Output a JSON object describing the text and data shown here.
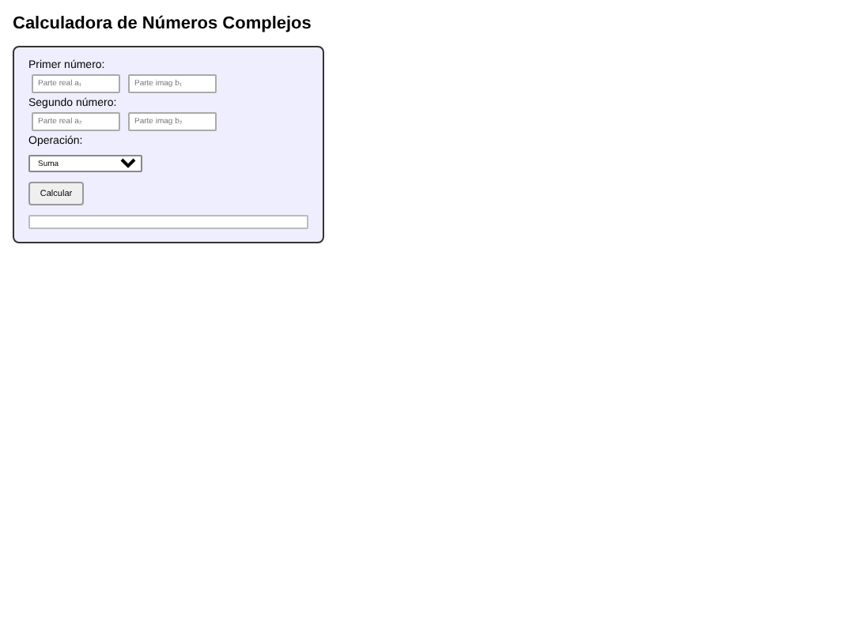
{
  "title": "Calculadora de Números Complejos",
  "groups": [
    {
      "label": "Primer número:",
      "fields": [
        {
          "placeholder": "Parte real a₁"
        },
        {
          "placeholder": "Parte imag b₁"
        }
      ]
    },
    {
      "label": "Segundo número:",
      "fields": [
        {
          "placeholder": "Parte real a₂"
        },
        {
          "placeholder": "Parte imag b₂"
        }
      ]
    }
  ],
  "operation": {
    "label": "Operación:",
    "value": "Suma"
  },
  "button": "Calcular"
}
